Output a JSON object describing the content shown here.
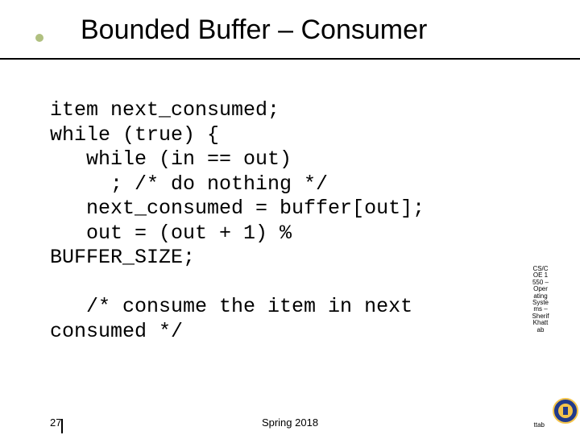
{
  "header": {
    "title": "Bounded Buffer – Consumer"
  },
  "code": {
    "lines": "item next_consumed;\nwhile (true) {\n   while (in == out)\n     ; /* do nothing */\n   next_consumed = buffer[out];\n   out = (out + 1) %\nBUFFER_SIZE;\n\n   /* consume the item in next\nconsumed */"
  },
  "sidebar": {
    "course": "CS/COE 1550 – Operating Systems – Sherif Khattab"
  },
  "footer": {
    "page": "27",
    "term": "Spring 2018",
    "last": "ttab"
  }
}
